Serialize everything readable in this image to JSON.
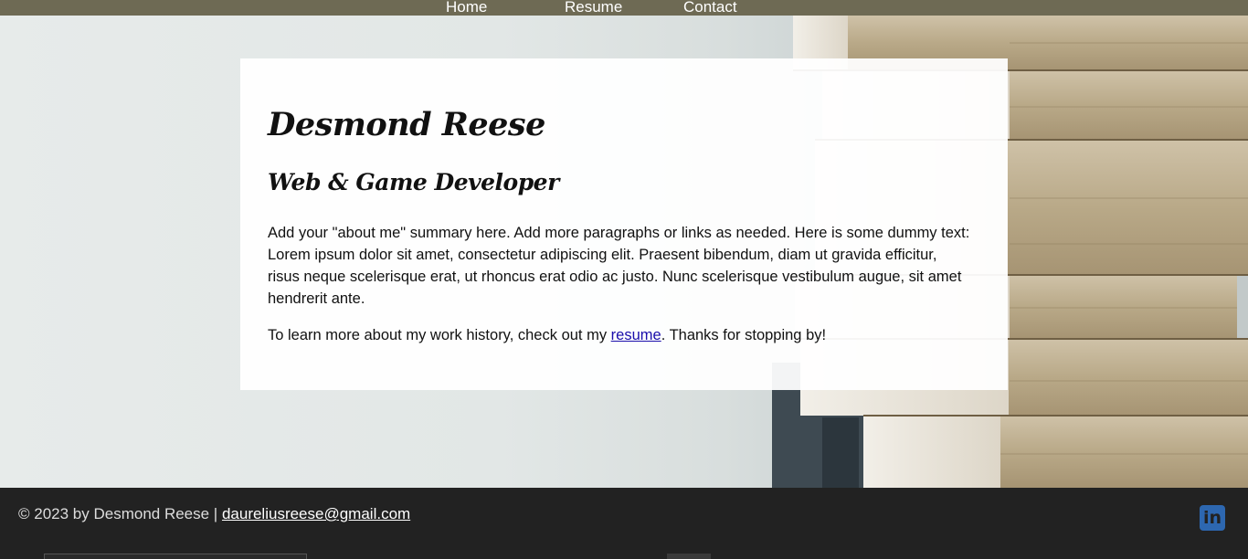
{
  "nav": {
    "items": [
      {
        "label": "Home"
      },
      {
        "label": "Resume"
      },
      {
        "label": "Contact"
      }
    ]
  },
  "intro": {
    "name": "Desmond Reese",
    "role": "Web & Game Developer",
    "about": "Add your \"about me\" summary here. Add more paragraphs or links as needed. Here is some dummy text: Lorem ipsum dolor sit amet, consectetur adipiscing elit. Praesent bibendum, diam ut gravida efficitur, risus neque scelerisque erat, ut rhoncus erat odio ac justo. Nunc scelerisque vestibulum augue, sit amet hendrerit ante.",
    "history_before": "To learn more about my work history, check out my ",
    "history_link": "resume",
    "history_after": ". Thanks for stopping by!"
  },
  "footer": {
    "copyright": "© 2023 by Desmond Reese | ",
    "email": "daureliusreese@gmail.com",
    "social_icon": "linkedin-icon"
  },
  "colors": {
    "nav_bg": "#6e6a54",
    "footer_bg": "#222222",
    "link": "#1a0dab",
    "linkedin": "#2d67b0"
  }
}
